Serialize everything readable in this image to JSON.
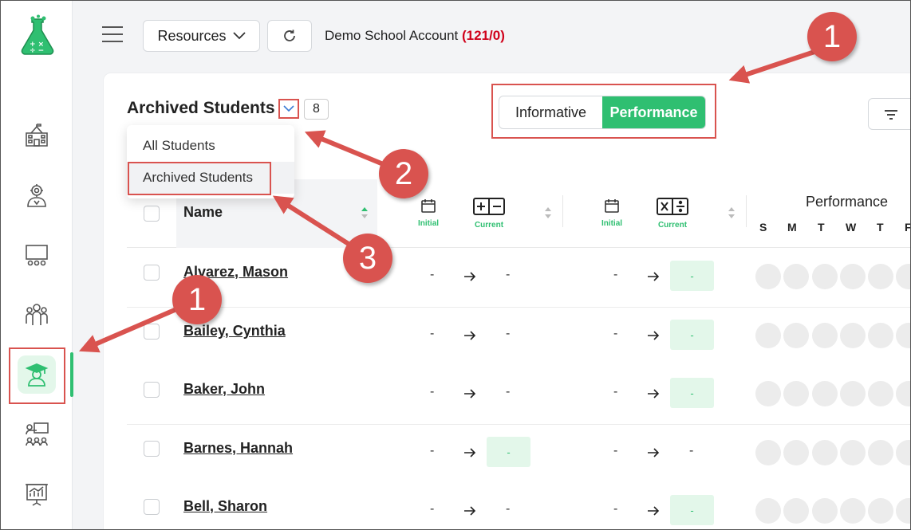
{
  "topbar": {
    "resources_label": "Resources",
    "account_name": "Demo School Account",
    "account_count": "(121/0)"
  },
  "sidebar": {
    "items": [
      {
        "icon": "school-icon"
      },
      {
        "icon": "admin-settings-icon"
      },
      {
        "icon": "classroom-icon"
      },
      {
        "icon": "groups-icon"
      },
      {
        "icon": "student-graduate-icon",
        "active": true
      },
      {
        "icon": "teacher-lesson-icon"
      },
      {
        "icon": "presentation-chart-icon"
      }
    ]
  },
  "main": {
    "title": "Archived Students",
    "count": "8",
    "view_toggle": {
      "options": [
        "Informative",
        "Performance"
      ],
      "selected": "Performance"
    },
    "dropdown": {
      "items": [
        "All Students",
        "Archived Students"
      ],
      "selected": "Archived Students"
    }
  },
  "table": {
    "name_header": "Name",
    "col_labels": {
      "initial": "Initial",
      "current": "Current"
    },
    "performance_header": "Performance",
    "days": [
      "S",
      "M",
      "T",
      "W",
      "T",
      "F"
    ],
    "rows": [
      {
        "name": "Alvarez, Mason",
        "a_init": "-",
        "a_cur": "-",
        "b_init": "-",
        "b_cur": "-"
      },
      {
        "name": "Bailey, Cynthia",
        "a_init": "-",
        "a_cur": "-",
        "b_init": "-",
        "b_cur": "-"
      },
      {
        "name": "Baker, John",
        "a_init": "-",
        "a_cur": "-",
        "b_init": "-",
        "b_cur": "-"
      },
      {
        "name": "Barnes, Hannah",
        "a_init": "-",
        "a_cur": "-",
        "b_init": "-",
        "b_cur": "-"
      },
      {
        "name": "Bell, Sharon",
        "a_init": "-",
        "a_cur": "-",
        "b_init": "-",
        "b_cur": "-"
      }
    ]
  },
  "annotations": {
    "labels": [
      "1",
      "2",
      "3",
      "1"
    ],
    "color": "#d9534f"
  },
  "colors": {
    "accent": "#2fbf71",
    "accent_light": "#e3f7ea",
    "alert": "#d0021b"
  }
}
